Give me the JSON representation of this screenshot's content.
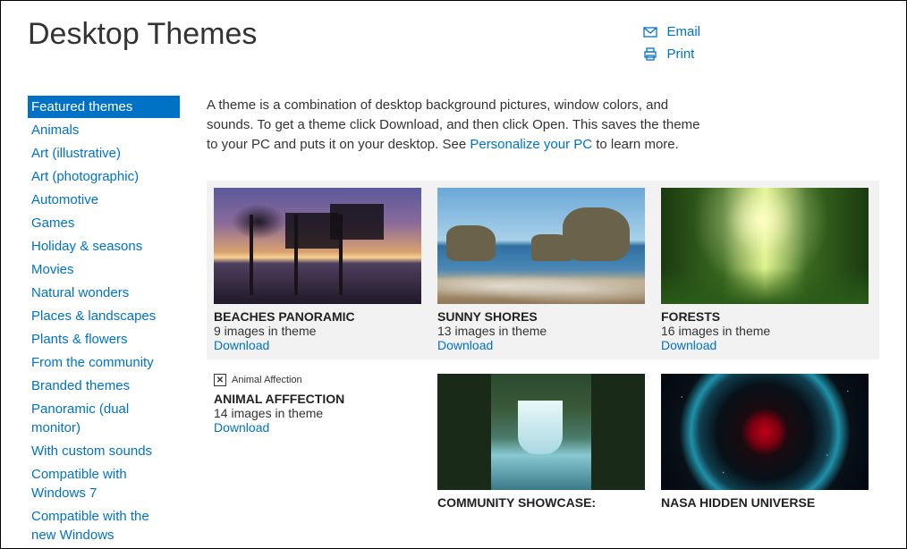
{
  "page": {
    "title": "Desktop Themes"
  },
  "header_actions": {
    "email": "Email",
    "print": "Print"
  },
  "sidebar": {
    "items": [
      {
        "label": "Featured themes",
        "selected": true
      },
      {
        "label": "Animals"
      },
      {
        "label": "Art (illustrative)"
      },
      {
        "label": "Art (photographic)"
      },
      {
        "label": "Automotive"
      },
      {
        "label": "Games"
      },
      {
        "label": "Holiday & seasons"
      },
      {
        "label": "Movies"
      },
      {
        "label": "Natural wonders"
      },
      {
        "label": "Places & landscapes"
      },
      {
        "label": "Plants & flowers"
      },
      {
        "label": "From the community"
      },
      {
        "label": "Branded themes"
      },
      {
        "label": "Panoramic (dual monitor)"
      },
      {
        "label": "With custom sounds"
      },
      {
        "label": "Compatible with Windows 7"
      },
      {
        "label": "Compatible with the new Windows"
      }
    ]
  },
  "intro": {
    "part1": "A theme is a combination of desktop background pictures, window colors, and sounds. To get a theme click Download, and then click Open. This saves the theme to your PC and puts it on your desktop. See ",
    "link": "Personalize your PC",
    "part2": " to learn more."
  },
  "themes": {
    "row1": [
      {
        "title": "BEACHES PANORAMIC",
        "meta": "9 images in theme",
        "download": "Download",
        "thumb": "beaches"
      },
      {
        "title": "SUNNY SHORES",
        "meta": "13 images in theme",
        "download": "Download",
        "thumb": "shores"
      },
      {
        "title": "FORESTS",
        "meta": "16 images in theme",
        "download": "Download",
        "thumb": "forests"
      }
    ],
    "row2": [
      {
        "title": "ANIMAL AFFFECTION",
        "meta": "14 images in theme",
        "download": "Download",
        "broken_alt": "Animal Affection",
        "thumb": "broken"
      },
      {
        "title": "COMMUNITY SHOWCASE:",
        "meta": "",
        "download": "",
        "thumb": "waterfall"
      },
      {
        "title": "NASA HIDDEN UNIVERSE",
        "meta": "",
        "download": "",
        "thumb": "nasa"
      }
    ]
  }
}
